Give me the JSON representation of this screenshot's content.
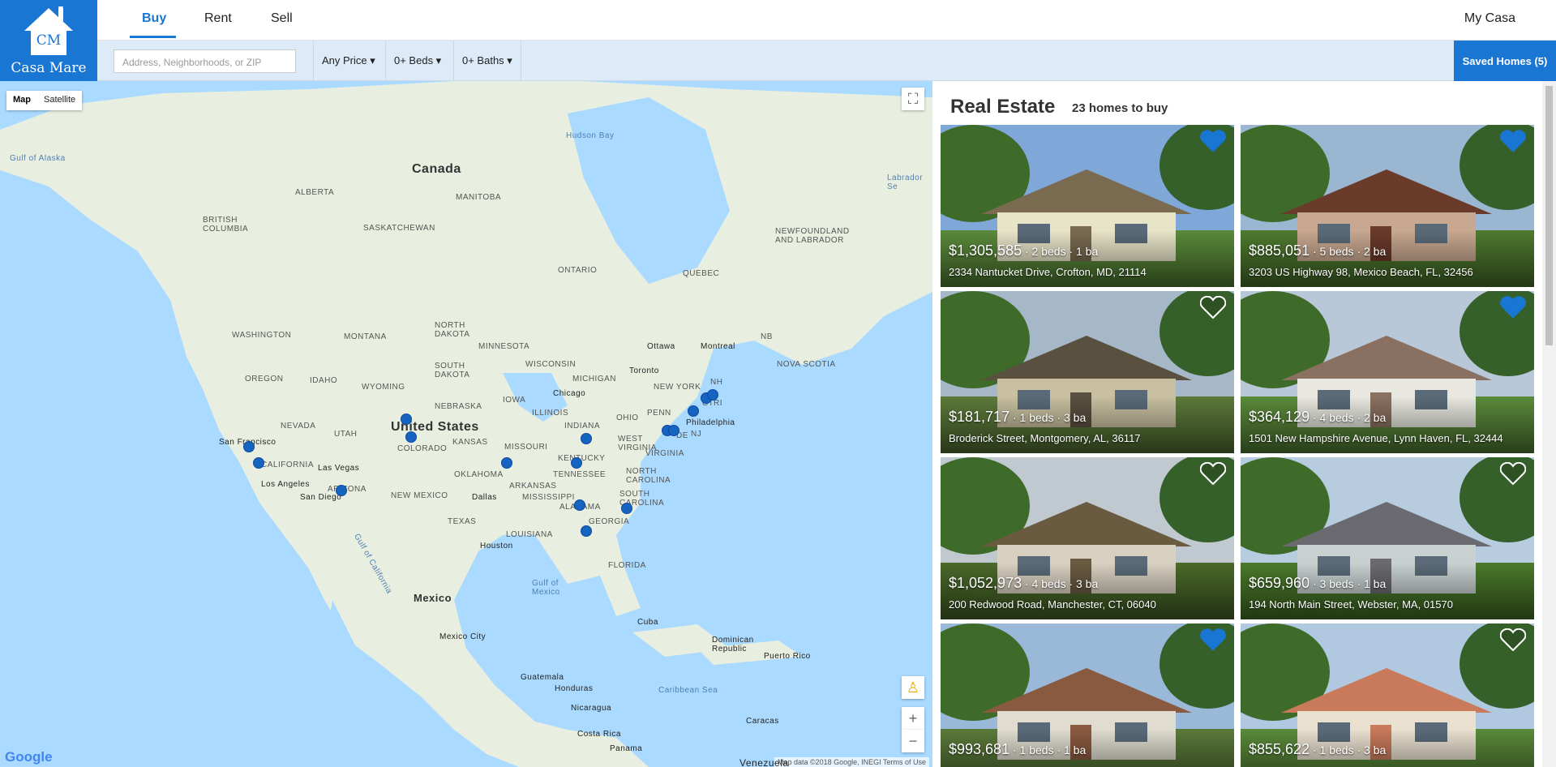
{
  "brand": {
    "logo_initials": "CM",
    "name": "Casa Mare",
    "color": "#1976d2"
  },
  "nav": {
    "tabs": [
      {
        "label": "Buy",
        "active": true
      },
      {
        "label": "Rent"
      },
      {
        "label": "Sell"
      }
    ],
    "account": "My Casa"
  },
  "filters": {
    "search_placeholder": "Address, Neighborhoods, or ZIP",
    "price": "Any Price ▾",
    "beds": "0+ Beds ▾",
    "baths": "0+ Baths ▾",
    "saved": "Saved Homes (5)"
  },
  "map": {
    "type_map": "Map",
    "type_satellite": "Satellite",
    "fullscreen_icon": "fullscreen-icon",
    "streetview_icon": "pegman-icon",
    "zoom_in": "+",
    "zoom_out": "−",
    "logo": "Google",
    "attribution": "Map data ©2018 Google, INEGI   Terms of Use",
    "labels": {
      "canada": "Canada",
      "united_states": "United States",
      "mexico": "Mexico",
      "hudson_bay": "Hudson Bay",
      "gulf_alaska": "Gulf of Alaska",
      "labrador_sea": "Labrador Se",
      "alberta": "ALBERTA",
      "manitoba": "MANITOBA",
      "saskatchewan": "SASKATCHEWAN",
      "british_columbia": "BRITISH\nCOLUMBIA",
      "ontario": "ONTARIO",
      "quebec": "QUEBEC",
      "newfoundland": "NEWFOUNDLAND\nAND LABRADOR",
      "washington": "WASHINGTON",
      "montana": "MONTANA",
      "north_dakota": "NORTH\nDAKOTA",
      "minnesota": "MINNESOTA",
      "oregon": "OREGON",
      "idaho": "IDAHO",
      "wyoming": "WYOMING",
      "south_dakota": "SOUTH\nDAKOTA",
      "wisconsin": "WISCONSIN",
      "michigan": "MICHIGAN",
      "new_york": "NEW YORK",
      "nebraska": "NEBRASKA",
      "iowa": "IOWA",
      "illinois": "ILLINOIS",
      "indiana": "INDIANA",
      "ohio": "OHIO",
      "penn": "PENN",
      "nevada": "NEVADA",
      "utah": "UTAH",
      "colorado": "COLORADO",
      "kansas": "KANSAS",
      "missouri": "MISSOURI",
      "kentucky": "KENTUCKY",
      "west_virginia": "WEST\nVIRGINIA",
      "virginia": "VIRGINIA",
      "california": "CALIFORNIA",
      "arizona": "ARIZONA",
      "new_mexico": "NEW MEXICO",
      "oklahoma": "OKLAHOMA",
      "arkansas": "ARKANSAS",
      "tennessee": "TENNESSEE",
      "north_carolina": "NORTH\nCAROLINA",
      "south_carolina": "SOUTH\nCAROLINA",
      "mississippi": "MISSISSIPPI",
      "alabama": "ALABAMA",
      "georgia": "GEORGIA",
      "texas": "TEXAS",
      "louisiana": "LOUISIANA",
      "florida": "FLORIDA",
      "nova_scotia": "NOVA SCOTIA",
      "nb": "NB",
      "nh": "NH",
      "ct": "CT",
      "ri": "RI",
      "de": "DE",
      "nj": "NJ",
      "ottawa": "Ottawa",
      "montreal": "Montreal",
      "toronto": "Toronto",
      "chicago": "Chicago",
      "philadelphia": "Philadelphia",
      "san_francisco": "San Francisco",
      "las_vegas": "Las Vegas",
      "los_angeles": "Los Angeles",
      "san_diego": "San Diego",
      "dallas": "Dallas",
      "houston": "Houston",
      "gulf_california": "Gulf of California",
      "gulf_mexico": "Gulf of\nMexico",
      "mexico_city": "Mexico City",
      "cuba": "Cuba",
      "dominican": "Dominican\nRepublic",
      "puerto_rico": "Puerto Rico",
      "guatemala": "Guatemala",
      "honduras": "Honduras",
      "nicaragua": "Nicaragua",
      "costa_rica": "Costa Rica",
      "panama": "Panama",
      "caribbean": "Caribbean Sea",
      "caracas": "Caracas",
      "venezuela": "Venezuela"
    }
  },
  "listings": {
    "title": "Real Estate",
    "count": "23 homes to buy",
    "heart_icon": "heart-icon",
    "items": [
      {
        "price": "$1,305,585",
        "details": " · 2 beds · 1 ba",
        "address": "2334 Nantucket Drive, Crofton, MD, 21114",
        "saved": true
      },
      {
        "price": "$885,051",
        "details": " · 5 beds · 2 ba",
        "address": "3203 US Highway 98, Mexico Beach, FL, 32456",
        "saved": true
      },
      {
        "price": "$181,717",
        "details": " · 1 beds · 3 ba",
        "address": "Broderick Street, Montgomery, AL, 36117",
        "saved": false
      },
      {
        "price": "$364,129",
        "details": " · 4 beds · 2 ba",
        "address": "1501 New Hampshire Avenue, Lynn Haven, FL, 32444",
        "saved": true
      },
      {
        "price": "$1,052,973",
        "details": " · 4 beds · 3 ba",
        "address": "200 Redwood Road, Manchester, CT, 06040",
        "saved": false
      },
      {
        "price": "$659,960",
        "details": " · 3 beds · 1 ba",
        "address": "194 North Main Street, Webster, MA, 01570",
        "saved": false
      },
      {
        "price": "$993,681",
        "details": " · 1 beds · 1 ba",
        "address": "",
        "saved": true
      },
      {
        "price": "$855,622",
        "details": " · 1 beds · 3 ba",
        "address": "",
        "saved": false
      }
    ]
  }
}
